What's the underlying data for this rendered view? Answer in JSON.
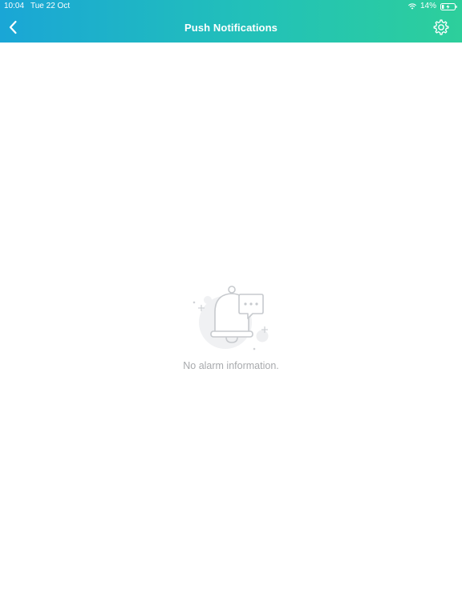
{
  "status_bar": {
    "time": "10:04",
    "date": "Tue 22 Oct",
    "battery": "14%"
  },
  "nav": {
    "title": "Push Notifications",
    "back_icon": "chevron-left-icon",
    "settings_icon": "gear-icon"
  },
  "empty_state": {
    "illustration_icon": "bell-with-message-icon",
    "message": "No alarm information."
  },
  "colors": {
    "header_gradient_start": "#1aa6d6",
    "header_gradient_end": "#2dcf9b",
    "empty_text": "#a8aaad",
    "background": "#ffffff"
  }
}
